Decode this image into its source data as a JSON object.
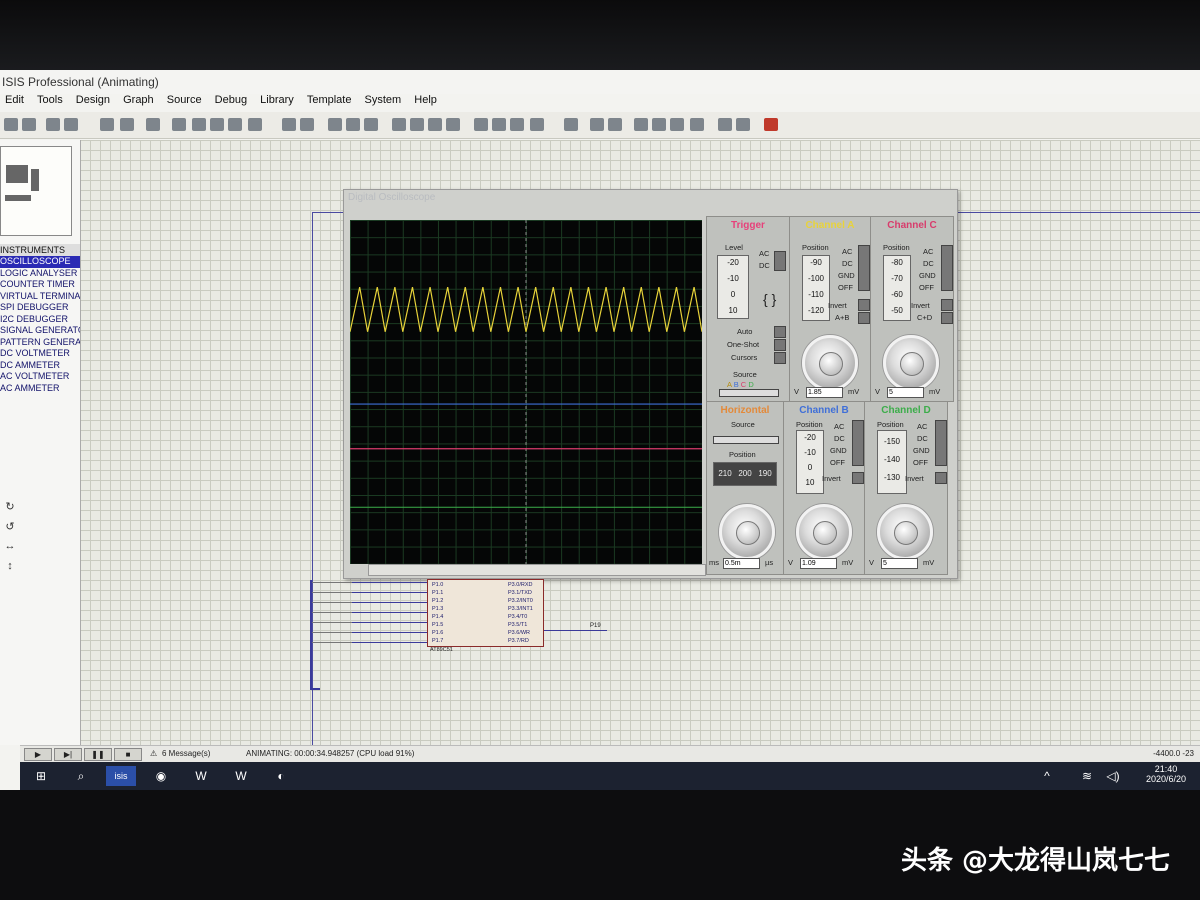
{
  "app": {
    "title": "ISIS Professional (Animating)"
  },
  "menu": [
    "Edit",
    "Tools",
    "Design",
    "Graph",
    "Source",
    "Debug",
    "Library",
    "Template",
    "System",
    "Help"
  ],
  "instruments": {
    "header": "INSTRUMENTS",
    "items": [
      "OSCILLOSCOPE",
      "LOGIC ANALYSER",
      "COUNTER TIMER",
      "VIRTUAL TERMINAL",
      "SPI DEBUGGER",
      "I2C DEBUGGER",
      "SIGNAL GENERATOR",
      "PATTERN GENERATOR",
      "DC VOLTMETER",
      "DC AMMETER",
      "AC VOLTMETER",
      "AC AMMETER"
    ],
    "selected_index": 0
  },
  "oscilloscope": {
    "title": "Digital Oscilloscope",
    "trigger": {
      "title": "Trigger",
      "level_label": "Level",
      "level_ticks": [
        "-20",
        "-10",
        "0",
        "10"
      ],
      "coupling": [
        "AC",
        "DC"
      ],
      "modes": [
        "Auto",
        "One-Shot",
        "Cursors"
      ],
      "source_label": "Source",
      "sources": [
        "A",
        "B",
        "C",
        "D"
      ]
    },
    "channel_a": {
      "title": "Channel A",
      "position_label": "Position",
      "ticks": [
        "-90",
        "-100",
        "-110",
        "-120"
      ],
      "coupling": [
        "AC",
        "DC",
        "GND",
        "OFF"
      ],
      "invert": "Invert",
      "combine": "A+B",
      "readout": "1.85",
      "unit_left": "V",
      "unit_right": "mV",
      "color": "#e8d33a"
    },
    "channel_b": {
      "title": "Channel B",
      "position_label": "Position",
      "ticks": [
        "-20",
        "-10",
        "0",
        "10"
      ],
      "coupling": [
        "AC",
        "DC",
        "GND",
        "OFF"
      ],
      "invert": "Invert",
      "readout": "1.09",
      "unit_left": "V",
      "unit_right": "mV",
      "color": "#3f6fd8"
    },
    "channel_c": {
      "title": "Channel C",
      "position_label": "Position",
      "ticks": [
        "-80",
        "-70",
        "-60",
        "-50"
      ],
      "coupling": [
        "AC",
        "DC",
        "GND",
        "OFF"
      ],
      "invert": "Invert",
      "combine": "C+D",
      "readout": "5",
      "unit_left": "V",
      "unit_right": "mV",
      "color": "#d83c6c"
    },
    "channel_d": {
      "title": "Channel D",
      "position_label": "Position",
      "ticks": [
        "-150",
        "-140",
        "-130"
      ],
      "coupling": [
        "AC",
        "DC",
        "GND",
        "OFF"
      ],
      "invert": "Invert",
      "readout": "5",
      "unit_left": "V",
      "unit_right": "mV",
      "color": "#3cad4a"
    },
    "horizontal": {
      "title": "Horizontal",
      "source_label": "Source",
      "position_label": "Position",
      "position_ticks": [
        "210",
        "200",
        "190"
      ],
      "readout": "0.5m",
      "unit_left": "ms",
      "unit_right": "µs"
    },
    "traces": {
      "a": {
        "type": "sawtooth",
        "cycles": 20,
        "level_frac": 0.26,
        "amplitude_frac": 0.13,
        "color": "#e8d33a"
      },
      "b": {
        "level_frac": 0.535,
        "color": "#3f6fd8"
      },
      "c": {
        "level_frac": 0.665,
        "color": "#d83c6c"
      },
      "d": {
        "level_frac": 0.835,
        "color": "#3cad4a"
      }
    }
  },
  "schematic": {
    "chip_name": "AT89C51",
    "left_pins": [
      "P1.0",
      "P1.1",
      "P1.2",
      "P1.3",
      "P1.4",
      "P1.5",
      "P1.6",
      "P1.7"
    ],
    "right_pins": [
      "P3.0/RXD",
      "P3.1/TXD",
      "P3.2/INT0",
      "P3.3/INT1",
      "P3.4/T0",
      "P3.5/T1",
      "P3.6/WR",
      "P3.7/RD"
    ],
    "right_labels": [
      "P3.0",
      "P3.1",
      "P3.2",
      "P3.3",
      "P3.4",
      "P3.5",
      "P3.6",
      "P3.7"
    ],
    "output_label": "P19"
  },
  "status": {
    "messages": "6 Message(s)",
    "animating": "ANIMATING: 00:00:34.948257 (CPU load 91%)",
    "coords": "-4400.0   -23"
  },
  "taskbar": {
    "time": "21:40",
    "date": "2020/6/20",
    "app_label": "isis"
  },
  "watermark": "头条 @大龙得山岚七七"
}
